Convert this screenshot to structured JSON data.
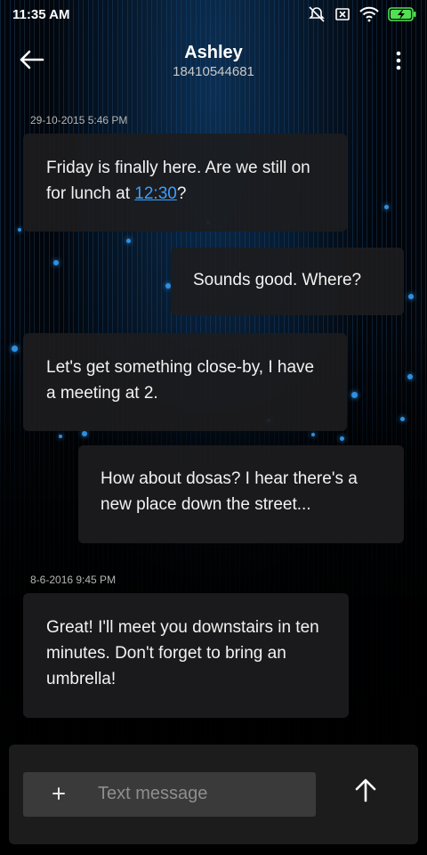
{
  "status_bar": {
    "time": "11:35 AM",
    "icons": [
      "alarm-off-icon",
      "sim-off-icon",
      "wifi-icon",
      "battery-charging-icon"
    ]
  },
  "header": {
    "contact_name": "Ashley",
    "contact_number": "18410544681",
    "back_icon": "arrow-left-icon",
    "menu_icon": "more-vert-icon"
  },
  "messages": [
    {
      "timestamp": "29-10-2015 5:46 PM"
    },
    {
      "direction": "incoming",
      "text_before": "Friday is finally here. Are we still on for lunch at ",
      "link": "12:30",
      "text_after": "?"
    },
    {
      "direction": "outgoing",
      "text": "Sounds good. Where?"
    },
    {
      "direction": "incoming",
      "text": "Let's get something close-by, I have a meeting at 2."
    },
    {
      "direction": "outgoing",
      "text": "How about dosas? I hear there's a new place down the street..."
    },
    {
      "timestamp": "8-6-2016 9:45 PM"
    },
    {
      "direction": "incoming",
      "text": "Great! I'll meet you downstairs in ten minutes. Don't forget to bring an umbrella!"
    }
  ],
  "composer": {
    "placeholder": "Text message",
    "attach_icon": "plus-icon",
    "send_icon": "arrow-up-icon"
  },
  "colors": {
    "background": "#000000",
    "bubble": "#1c1c1e",
    "link": "#3aa0ff",
    "accent_blue": "#2f8fe0"
  }
}
